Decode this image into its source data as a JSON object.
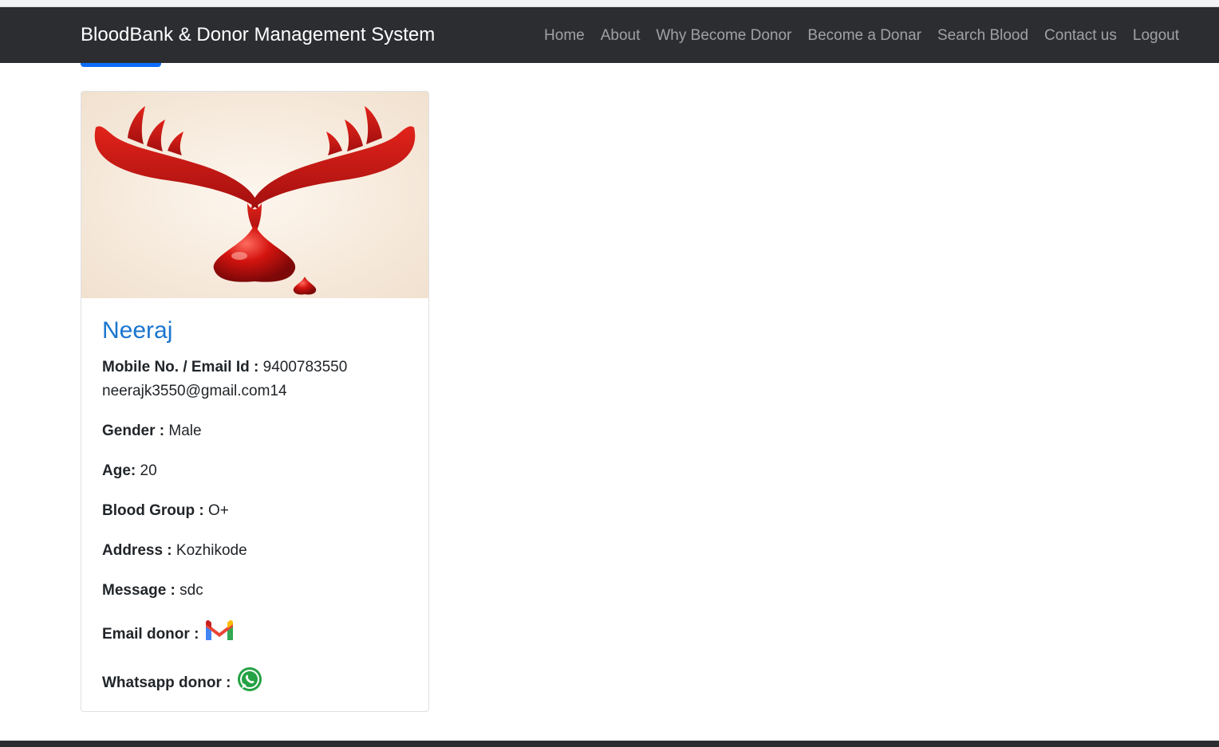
{
  "navbar": {
    "brand": "BloodBank & Donor Management System",
    "links": [
      "Home",
      "About",
      "Why Become Donor",
      "Become a Donar",
      "Search Blood",
      "Contact us",
      "Logout"
    ]
  },
  "donor": {
    "name": "Neeraj",
    "contact_label": "Mobile No. / Email Id :",
    "mobile": "9400783550",
    "email": "neerajk3550@gmail.com14",
    "gender_label": "Gender :",
    "gender": "Male",
    "age_label": "Age:",
    "age": "20",
    "blood_group_label": "Blood Group :",
    "blood_group": "O+",
    "address_label": "Address :",
    "address": "Kozhikode",
    "message_label": "Message :",
    "message": "sdc",
    "email_donor_label": "Email donor :",
    "whatsapp_donor_label": "Whatsapp donor :"
  },
  "icons": {
    "donor_image": "blood-donation-hands-image",
    "email": "gmail-icon",
    "whatsapp": "whatsapp-icon"
  },
  "colors": {
    "navbar_bg": "#2b2d31",
    "accent": "#0d6efd",
    "name": "#1a75cf"
  }
}
